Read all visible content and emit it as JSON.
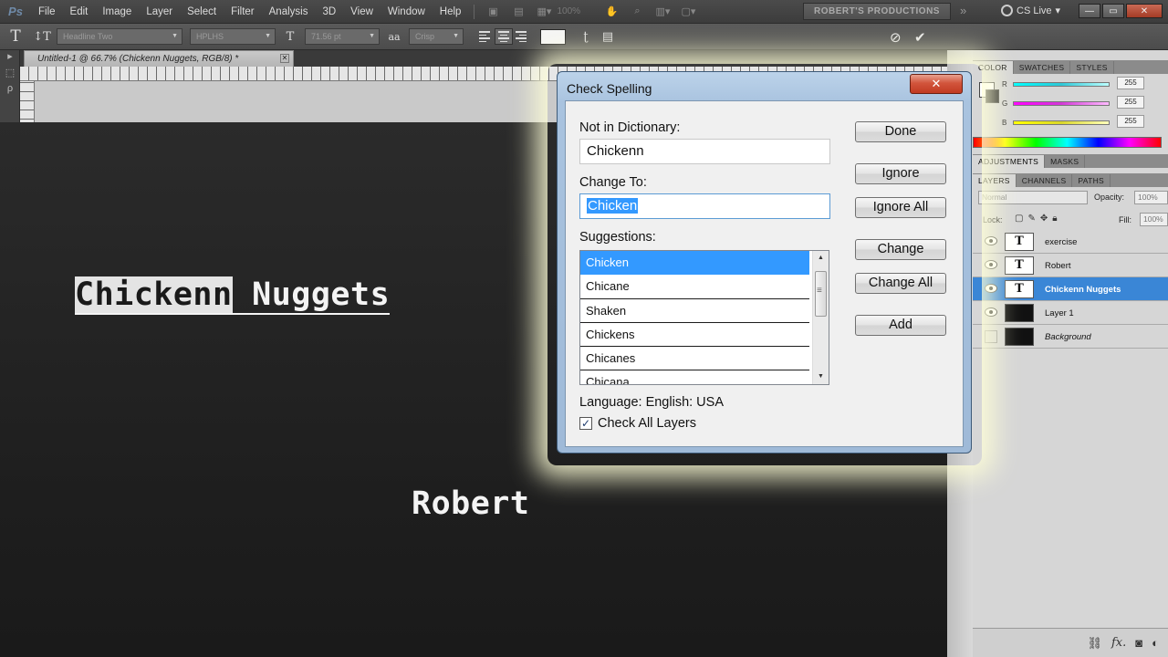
{
  "menubar": {
    "logo": "Ps",
    "items": [
      "File",
      "Edit",
      "Image",
      "Layer",
      "Select",
      "Filter",
      "Analysis",
      "3D",
      "View",
      "Window",
      "Help"
    ],
    "zoom": "100%",
    "workspace": "ROBERT'S PRODUCTIONS",
    "cs_live": "CS Live",
    "window_controls": [
      "—",
      "▭",
      "✕"
    ]
  },
  "optionsbar": {
    "tool_icon": "T",
    "font_family": "Headline Two",
    "font_style": "HPLHS",
    "font_size": "71.56 pt",
    "antialias_icon": "aa",
    "antialias": "Crisp"
  },
  "document": {
    "tab_title": "Untitled-1 @ 66.7% (Chickenn Nuggets, RGB/8) *",
    "tab_close": "✕",
    "text_misspelled": "Chickenn",
    "text_rest": " Nuggets",
    "text_second": "Robert"
  },
  "panels": {
    "color_tabs": [
      "COLOR",
      "SWATCHES",
      "STYLES"
    ],
    "color_channels": [
      {
        "label": "R",
        "value": "255",
        "color": "#2fc7d6"
      },
      {
        "label": "G",
        "value": "255",
        "color": "#d23ad6"
      },
      {
        "label": "B",
        "value": "255",
        "color": "#d9d62a"
      }
    ],
    "adjust_tabs": [
      "ADJUSTMENTS",
      "MASKS"
    ],
    "layer_tabs": [
      "LAYERS",
      "CHANNELS",
      "PATHS"
    ],
    "blend_mode": "Normal",
    "opacity_label": "Opacity:",
    "opacity_value": "100%",
    "lock_label": "Lock:",
    "fill_label": "Fill:",
    "fill_value": "100%",
    "layers": [
      {
        "name": "exercise",
        "type": "text"
      },
      {
        "name": "Robert",
        "type": "text"
      },
      {
        "name": "Chickenn Nuggets",
        "type": "text",
        "selected": true
      },
      {
        "name": "Layer 1",
        "type": "fill"
      },
      {
        "name": "Background",
        "type": "background"
      }
    ]
  },
  "dialog": {
    "title": "Check Spelling",
    "close": "✕",
    "not_in_dictionary_label": "Not in Dictionary:",
    "not_in_dictionary_value": "Chickenn",
    "change_to_label": "Change To:",
    "change_to_value": "Chicken",
    "suggestions_label": "Suggestions:",
    "suggestions": [
      "Chicken",
      "Chicane",
      "Shaken",
      "Chickens",
      "Chicanes",
      "Chicana"
    ],
    "buttons": {
      "done": "Done",
      "ignore": "Ignore",
      "ignore_all": "Ignore All",
      "change": "Change",
      "change_all": "Change All",
      "add": "Add"
    },
    "language": "Language: English: USA",
    "check_all_layers": "Check All Layers",
    "check_all_layers_checked": true
  }
}
